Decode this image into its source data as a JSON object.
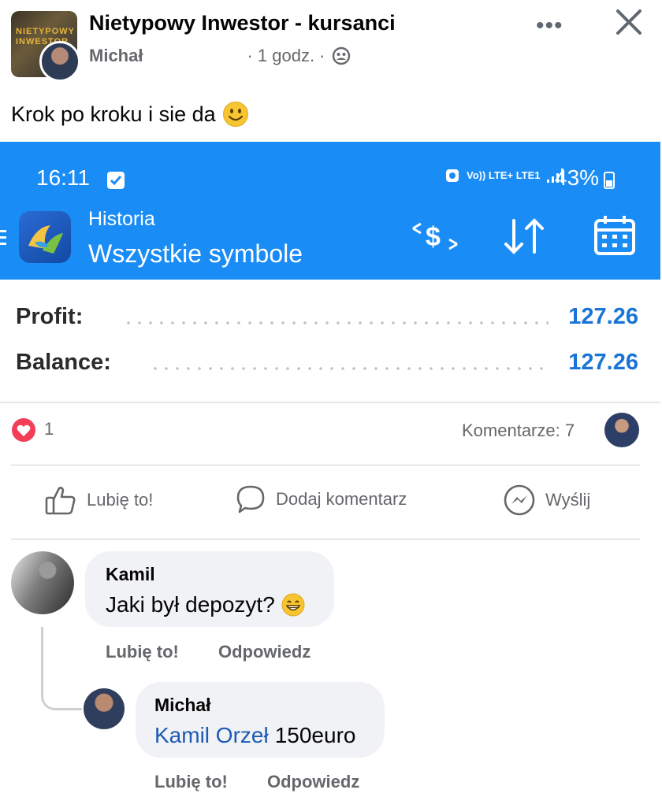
{
  "post": {
    "group_name": "Nietypowy Inwestor - kursanci",
    "group_avatar_text": "NIETYPOWY INWESTOR",
    "author": "Michał",
    "time": "· 1 godz. ·",
    "text": "Krok po kroku i sie da",
    "more_icon": "more-horizontal-icon",
    "close_icon": "close-icon"
  },
  "screenshot": {
    "status_time": "16:11",
    "status_network": "Vo)) LTE+ LTE1",
    "battery": "43%",
    "subtitle": "Historia",
    "title": "Wszystkie symbole",
    "bar_color": "#1a8cf5",
    "rows": [
      {
        "label": "Profit:",
        "value": "127.26"
      },
      {
        "label": "Balance:",
        "value": "127.26"
      }
    ]
  },
  "reactions": {
    "likes": "1",
    "comments": "Komentarze: 7"
  },
  "actions": {
    "like": "Lubię to!",
    "comment": "Dodaj komentarz",
    "send": "Wyślij"
  },
  "comments": [
    {
      "name": "Kamil",
      "text": "Jaki był depozyt?",
      "emoji": "grinning-face",
      "like": "Lubię to!",
      "reply": "Odpowiedz"
    },
    {
      "name": "Michał",
      "mention": "Kamil Orzeł",
      "text": "150euro",
      "like": "Lubię to!",
      "reply": "Odpowiedz"
    }
  ]
}
